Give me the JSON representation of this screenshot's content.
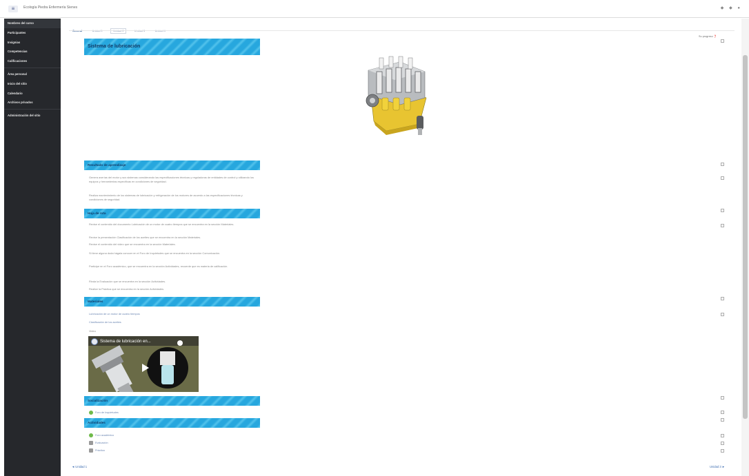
{
  "topbar": {
    "menu_icon": "hamburger-icon",
    "site_title": "Ecología Piedra Enfermería Sienes",
    "icons": "notification-icon, message-icon, user-icon"
  },
  "sidebar": {
    "items": [
      {
        "label": "Nombres del curso"
      },
      {
        "label": "Participantes"
      },
      {
        "label": "Insignias"
      },
      {
        "label": "Competencias"
      },
      {
        "label": "Calificaciones"
      },
      {
        "label": "Área personal"
      },
      {
        "label": "Inicio del sitio"
      },
      {
        "label": "Calendario"
      },
      {
        "label": "Archivos privados"
      },
      {
        "label": "Administración del sitio"
      }
    ]
  },
  "tabs": [
    {
      "label": "General"
    },
    {
      "label": "Unidad 1"
    },
    {
      "label": "Unidad 2"
    },
    {
      "label": "Unidad 3"
    },
    {
      "label": "Unidad 4"
    }
  ],
  "progress_label": "Su progreso",
  "sections": {
    "title": "Sistema de lubricación",
    "results_heading": "Resultado de aprendizaje",
    "route_heading": "Hoja de ruta",
    "materials_heading": "Materiales",
    "socialization_heading": "Socialización",
    "activities_heading": "Actividades"
  },
  "results_paras": [
    "Genera averías del motor y sus sistemas considerando las especificaciones técnicas y reguladoras de entidades de control y utilizando los equipos y herramientas específicas en condiciones de seguridad.",
    "Realiza mantenimiento de los sistemas de lubricación y refrigeración de los motores de acuerdo a las especificaciones técnicas y condiciones de seguridad."
  ],
  "route_paras": [
    "Revise el contenido del documento Lubricación de un motor de cuatro tiempos que se encuentra en la sección Materiales.",
    "Revise la presentación Clasificación de los aceites que se encuentra en la sección Materiales.",
    "Revise el contenido del video que se encuentra en la sección Materiales.",
    "Si tiene alguna duda hágala conocer en el Foro de Inquietudes que se encuentra en la sección Comunicación.",
    "Participe en el Foro académico, que se encuentra en la sección Actividades, recuerde que es materia de calificación.",
    "Rinda la Evaluación que se encuentra en la sección Actividades.",
    "Realice la Práctica que se encuentra en la sección Actividades."
  ],
  "materials_links": [
    "Lubricación de un motor de cuatro tiempos",
    "Clasificación de los aceites"
  ],
  "video": {
    "label": "Video",
    "title": "Sistema de lubricación en..."
  },
  "socialization_items": [
    "Foro de Inquietudes"
  ],
  "activity_items": [
    "Foro académico",
    "Evaluación",
    "Práctica"
  ],
  "footer": {
    "prev": "◄ Unidad 1",
    "next": "Unidad 3 ►"
  },
  "colors": {
    "sidebar_bg": "#26282c",
    "banner": "#27a7de",
    "banner_text": "#123a66",
    "link": "#6b86b2"
  }
}
